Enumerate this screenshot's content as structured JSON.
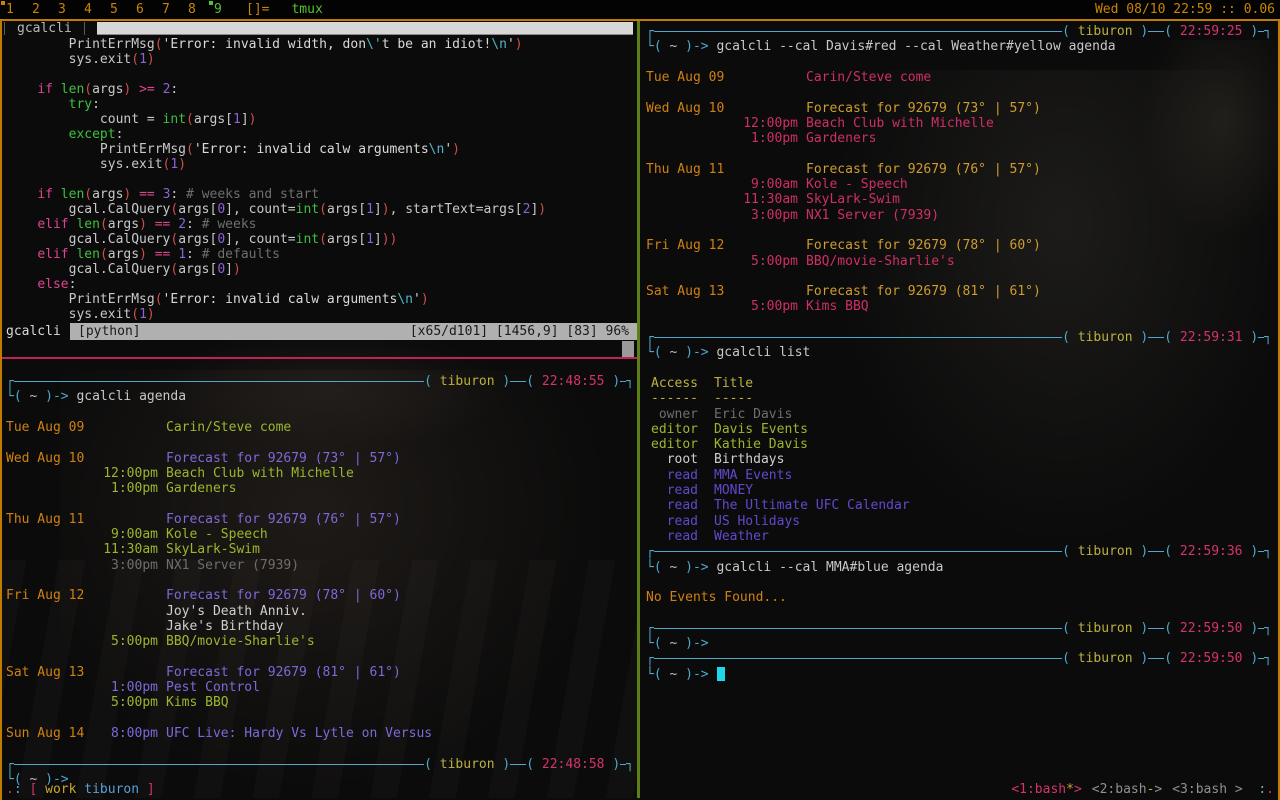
{
  "dwm_bar": {
    "tags": [
      "1",
      "2",
      "3",
      "4",
      "5",
      "6",
      "7",
      "8",
      "9"
    ],
    "selected_tag": "9",
    "tag_indicators": {
      "1": "orange",
      "9": "green"
    },
    "layout_indicator": "[]=",
    "window_title": "tmux",
    "clock": "Wed 08/10 22:59 :: 0.06"
  },
  "vim": {
    "tab_label": "gcalcli",
    "statusline": {
      "file": "gcalcli",
      "filetype": "[python]",
      "ruler": "[x65/d101] [1456,9] [83] 96%"
    },
    "code_lines": [
      [
        [
          "        PrintErrMsg",
          "t"
        ],
        [
          "(",
          "p"
        ],
        [
          "'Error: invalid width, don",
          "s"
        ],
        [
          "\\'",
          "e"
        ],
        [
          "t be an idiot!",
          "s"
        ],
        [
          "\\n",
          "e"
        ],
        [
          "'",
          "s"
        ],
        [
          ")",
          "p"
        ]
      ],
      [
        [
          "        sys.exit",
          "t"
        ],
        [
          "(",
          "p"
        ],
        [
          "1",
          "n"
        ],
        [
          ")",
          "p"
        ]
      ],
      [],
      [
        [
          "    ",
          "t"
        ],
        [
          "if",
          "k"
        ],
        [
          " ",
          "t"
        ],
        [
          "len",
          "g"
        ],
        [
          "(",
          "p"
        ],
        [
          "args",
          "t"
        ],
        [
          ")",
          "p"
        ],
        [
          " ",
          "t"
        ],
        [
          ">=",
          "k"
        ],
        [
          " ",
          "t"
        ],
        [
          "2",
          "n"
        ],
        [
          ":",
          "t"
        ]
      ],
      [
        [
          "        ",
          "t"
        ],
        [
          "try",
          "g"
        ],
        [
          ":",
          "t"
        ]
      ],
      [
        [
          "            count = ",
          "t"
        ],
        [
          "int",
          "g"
        ],
        [
          "(",
          "p"
        ],
        [
          "args[",
          "t"
        ],
        [
          "1",
          "n"
        ],
        [
          "]",
          "t"
        ],
        [
          ")",
          "p"
        ]
      ],
      [
        [
          "        ",
          "t"
        ],
        [
          "except",
          "g"
        ],
        [
          ":",
          "t"
        ]
      ],
      [
        [
          "            PrintErrMsg",
          "t"
        ],
        [
          "(",
          "p"
        ],
        [
          "'Error: invalid calw arguments",
          "s"
        ],
        [
          "\\n",
          "e"
        ],
        [
          "'",
          "s"
        ],
        [
          ")",
          "p"
        ]
      ],
      [
        [
          "            sys.exit",
          "t"
        ],
        [
          "(",
          "p"
        ],
        [
          "1",
          "n"
        ],
        [
          ")",
          "p"
        ]
      ],
      [],
      [
        [
          "    ",
          "t"
        ],
        [
          "if",
          "k"
        ],
        [
          " ",
          "t"
        ],
        [
          "len",
          "g"
        ],
        [
          "(",
          "p"
        ],
        [
          "args",
          "t"
        ],
        [
          ")",
          "p"
        ],
        [
          " ",
          "t"
        ],
        [
          "==",
          "k"
        ],
        [
          " ",
          "t"
        ],
        [
          "3",
          "n"
        ],
        [
          ": ",
          "t"
        ],
        [
          "# weeks and start",
          "c"
        ]
      ],
      [
        [
          "        gcal.CalQuery",
          "t"
        ],
        [
          "(",
          "p"
        ],
        [
          "args[",
          "t"
        ],
        [
          "0",
          "n"
        ],
        [
          "], count=",
          "t"
        ],
        [
          "int",
          "g"
        ],
        [
          "(",
          "p"
        ],
        [
          "args[",
          "t"
        ],
        [
          "1",
          "n"
        ],
        [
          "]",
          "t"
        ],
        [
          ")",
          "p"
        ],
        [
          ", startText=args[",
          "t"
        ],
        [
          "2",
          "n"
        ],
        [
          "]",
          "t"
        ],
        [
          ")",
          "p"
        ]
      ],
      [
        [
          "    ",
          "t"
        ],
        [
          "elif",
          "k"
        ],
        [
          " ",
          "t"
        ],
        [
          "len",
          "g"
        ],
        [
          "(",
          "p"
        ],
        [
          "args",
          "t"
        ],
        [
          ")",
          "p"
        ],
        [
          " ",
          "t"
        ],
        [
          "==",
          "k"
        ],
        [
          " ",
          "t"
        ],
        [
          "2",
          "n"
        ],
        [
          ": ",
          "t"
        ],
        [
          "# weeks",
          "c"
        ]
      ],
      [
        [
          "        gcal.CalQuery",
          "t"
        ],
        [
          "(",
          "p"
        ],
        [
          "args[",
          "t"
        ],
        [
          "0",
          "n"
        ],
        [
          "], count=",
          "t"
        ],
        [
          "int",
          "g"
        ],
        [
          "(",
          "p"
        ],
        [
          "args[",
          "t"
        ],
        [
          "1",
          "n"
        ],
        [
          "]",
          "t"
        ],
        [
          "))",
          "p"
        ]
      ],
      [
        [
          "    ",
          "t"
        ],
        [
          "elif",
          "k"
        ],
        [
          " ",
          "t"
        ],
        [
          "len",
          "g"
        ],
        [
          "(",
          "p"
        ],
        [
          "args",
          "t"
        ],
        [
          ")",
          "p"
        ],
        [
          " ",
          "t"
        ],
        [
          "==",
          "k"
        ],
        [
          " ",
          "t"
        ],
        [
          "1",
          "n"
        ],
        [
          ": ",
          "t"
        ],
        [
          "# defaults",
          "c"
        ]
      ],
      [
        [
          "        gcal.CalQuery",
          "t"
        ],
        [
          "(",
          "p"
        ],
        [
          "args[",
          "t"
        ],
        [
          "0",
          "n"
        ],
        [
          "]",
          "t"
        ],
        [
          ")",
          "p"
        ]
      ],
      [
        [
          "    ",
          "t"
        ],
        [
          "else",
          "k"
        ],
        [
          ":",
          "t"
        ]
      ],
      [
        [
          "        PrintErrMsg",
          "t"
        ],
        [
          "(",
          "p"
        ],
        [
          "'Error: invalid calw arguments",
          "s"
        ],
        [
          "\\n",
          "e"
        ],
        [
          "'",
          "s"
        ],
        [
          ")",
          "p"
        ]
      ],
      [
        [
          "        sys.exit",
          "t"
        ],
        [
          "(",
          "p"
        ],
        [
          "1",
          "n"
        ],
        [
          ")",
          "p"
        ]
      ]
    ]
  },
  "shell": {
    "host": "tiburon",
    "cwd": "~",
    "box_open": "┌",
    "box_hook": "┐",
    "corner": "└",
    "label_open": "( ",
    "label_close": " )",
    "prompt_open": "( ",
    "prompt_close": " )-> "
  },
  "left_terminal": {
    "lines": [
      {
        "t": "header",
        "time": "22:48:55"
      },
      {
        "t": "prompt",
        "cmd": "gcalcli agenda"
      },
      {
        "t": "blank"
      },
      {
        "t": "row",
        "date": "Tue Aug 09",
        "time": "",
        "desc": "Carin/Steve come",
        "c": "green"
      },
      {
        "t": "blank"
      },
      {
        "t": "row",
        "date": "Wed Aug 10",
        "time": "",
        "desc": "Forecast for 92679 (73° | 57°)",
        "c": "violet"
      },
      {
        "t": "row",
        "date": "",
        "time": "12:00pm",
        "desc": "Beach Club with Michelle",
        "c": "green"
      },
      {
        "t": "row",
        "date": "",
        "time": "1:00pm",
        "desc": "Gardeners",
        "c": "green"
      },
      {
        "t": "blank"
      },
      {
        "t": "row",
        "date": "Thu Aug 11",
        "time": "",
        "desc": "Forecast for 92679 (76° | 57°)",
        "c": "violet"
      },
      {
        "t": "row",
        "date": "",
        "time": "9:00am",
        "desc": "Kole - Speech",
        "c": "green"
      },
      {
        "t": "row",
        "date": "",
        "time": "11:30am",
        "desc": "SkyLark-Swim",
        "c": "green"
      },
      {
        "t": "row",
        "date": "",
        "time": "3:00pm",
        "desc": "NX1 Server (7939)",
        "c": "grey"
      },
      {
        "t": "blank"
      },
      {
        "t": "row",
        "date": "Fri Aug 12",
        "time": "",
        "desc": "Forecast for 92679 (78° | 60°)",
        "c": "violet"
      },
      {
        "t": "row",
        "date": "",
        "time": "",
        "desc": "Joy's Death Anniv.",
        "c": "white"
      },
      {
        "t": "row",
        "date": "",
        "time": "",
        "desc": "Jake's Birthday",
        "c": "white"
      },
      {
        "t": "row",
        "date": "",
        "time": "5:00pm",
        "desc": "BBQ/movie-Sharlie's",
        "c": "green"
      },
      {
        "t": "blank"
      },
      {
        "t": "row",
        "date": "Sat Aug 13",
        "time": "",
        "desc": "Forecast for 92679 (81° | 61°)",
        "c": "violet"
      },
      {
        "t": "row",
        "date": "",
        "time": "1:00pm",
        "desc": "Pest Control",
        "c": "violet"
      },
      {
        "t": "row",
        "date": "",
        "time": "5:00pm",
        "desc": "Kims BBQ",
        "c": "green"
      },
      {
        "t": "blank"
      },
      {
        "t": "row",
        "date": "Sun Aug 14",
        "time": "8:00pm",
        "desc": "UFC Live: Hardy Vs Lytle on Versus",
        "c": "violet"
      },
      {
        "t": "blank"
      },
      {
        "t": "header",
        "time": "22:48:58"
      },
      {
        "t": "prompt",
        "cmd": ""
      }
    ]
  },
  "right_terminal": {
    "lines": [
      {
        "t": "header",
        "time": "22:59:25"
      },
      {
        "t": "prompt",
        "cmd": "gcalcli --cal Davis#red --cal Weather#yellow agenda"
      },
      {
        "t": "blank"
      },
      {
        "t": "row",
        "date": "Tue Aug 09",
        "time": "",
        "desc": "Carin/Steve come",
        "c": "red"
      },
      {
        "t": "blank"
      },
      {
        "t": "row",
        "date": "Wed Aug 10",
        "time": "",
        "desc": "Forecast for 92679 (73° | 57°)",
        "c": "amber"
      },
      {
        "t": "row",
        "date": "",
        "time": "12:00pm",
        "desc": "Beach Club with Michelle",
        "c": "red"
      },
      {
        "t": "row",
        "date": "",
        "time": "1:00pm",
        "desc": "Gardeners",
        "c": "red"
      },
      {
        "t": "blank"
      },
      {
        "t": "row",
        "date": "Thu Aug 11",
        "time": "",
        "desc": "Forecast for 92679 (76° | 57°)",
        "c": "amber"
      },
      {
        "t": "row",
        "date": "",
        "time": "9:00am",
        "desc": "Kole - Speech",
        "c": "red"
      },
      {
        "t": "row",
        "date": "",
        "time": "11:30am",
        "desc": "SkyLark-Swim",
        "c": "red"
      },
      {
        "t": "row",
        "date": "",
        "time": "3:00pm",
        "desc": "NX1 Server (7939)",
        "c": "red"
      },
      {
        "t": "blank"
      },
      {
        "t": "row",
        "date": "Fri Aug 12",
        "time": "",
        "desc": "Forecast for 92679 (78° | 60°)",
        "c": "amber"
      },
      {
        "t": "row",
        "date": "",
        "time": "5:00pm",
        "desc": "BBQ/movie-Sharlie's",
        "c": "red"
      },
      {
        "t": "blank"
      },
      {
        "t": "row",
        "date": "Sat Aug 13",
        "time": "",
        "desc": "Forecast for 92679 (81° | 61°)",
        "c": "amber"
      },
      {
        "t": "row",
        "date": "",
        "time": "5:00pm",
        "desc": "Kims BBQ",
        "c": "red"
      },
      {
        "t": "blank"
      },
      {
        "t": "header",
        "time": "22:59:31"
      },
      {
        "t": "prompt",
        "cmd": "gcalcli list"
      },
      {
        "t": "blank"
      },
      {
        "t": "listhead",
        "access": "Access",
        "title": "Title"
      },
      {
        "t": "listhead",
        "access": "------",
        "title": "-----"
      },
      {
        "t": "list",
        "access": "owner",
        "title": "Eric Davis",
        "c": "grey"
      },
      {
        "t": "list",
        "access": "editor",
        "title": "Davis Events",
        "c": "green"
      },
      {
        "t": "list",
        "access": "editor",
        "title": "Kathie Davis",
        "c": "green"
      },
      {
        "t": "list",
        "access": "root",
        "title": "Birthdays",
        "c": "white"
      },
      {
        "t": "list",
        "access": "read",
        "title": "MMA Events",
        "c": "purple"
      },
      {
        "t": "list",
        "access": "read",
        "title": "MONEY",
        "c": "purple"
      },
      {
        "t": "list",
        "access": "read",
        "title": "The Ultimate UFC Calendar",
        "c": "purple"
      },
      {
        "t": "list",
        "access": "read",
        "title": "US Holidays",
        "c": "purple"
      },
      {
        "t": "list",
        "access": "read",
        "title": "Weather",
        "c": "purple"
      },
      {
        "t": "header",
        "time": "22:59:36"
      },
      {
        "t": "prompt",
        "cmd": "gcalcli --cal MMA#blue agenda"
      },
      {
        "t": "blank"
      },
      {
        "t": "msg",
        "text": "No Events Found...",
        "c": "orange"
      },
      {
        "t": "blank"
      },
      {
        "t": "header",
        "time": "22:59:50"
      },
      {
        "t": "prompt",
        "cmd": ""
      },
      {
        "t": "header",
        "time": "22:59:50"
      },
      {
        "t": "prompt",
        "cmd": "",
        "cursor": true
      }
    ]
  },
  "tmux_status": {
    "left": {
      "dot": ".",
      "colon": ":",
      "open": "[",
      "session": "work",
      "host": "tiburon",
      "close": "]"
    },
    "windows": [
      {
        "label": "<1:bash",
        "flag": "*",
        "close": ">",
        "active": true
      },
      {
        "label": "<2:bash",
        "flag": "-",
        "close": ">",
        "active": false
      },
      {
        "label": "<3:bash",
        "flag": " ",
        "close": ">",
        "active": false
      }
    ],
    "trail": {
      "colon": ":",
      "dot": "."
    }
  },
  "colors": {
    "orange": "#d08010",
    "green": "#9cb62c",
    "violet": "#7f68d8",
    "purple": "#6448cc",
    "red": "#cf2f66",
    "amber": "#cf9c2e",
    "yellow": "#bbb040",
    "white": "#cfcfcf",
    "grey": "#6e6e6e",
    "cyan": "#4fa8cc",
    "bright_cyan": "#1fd7e8",
    "header_time": "#d4336e",
    "command": "#c8c8c8",
    "tilde": "#bdbdbd",
    "code": {
      "t": "#c8c8c8",
      "s": "#d9d9d9",
      "k": "#dd4590",
      "g": "#3fbf3f",
      "n": "#8a63d6",
      "p": "#cc4f4f",
      "e": "#4db8c8",
      "c": "#6e6e6e"
    },
    "dwm": {
      "tag": "#cc8400",
      "active": "#55c22e",
      "clock": "#cc8400",
      "indicator_orange": "#cc8400",
      "indicator_green": "#55c22e"
    },
    "tmux": {
      "active": "#d4336e",
      "inactive": "#909090",
      "flag": "#c9a92e",
      "session": "#c9a92e",
      "host_blue": "#5b9fd4",
      "bracket": "#d4336e",
      "colon": "#4fa8cc",
      "trail_colon": "#7aa8b8"
    }
  }
}
